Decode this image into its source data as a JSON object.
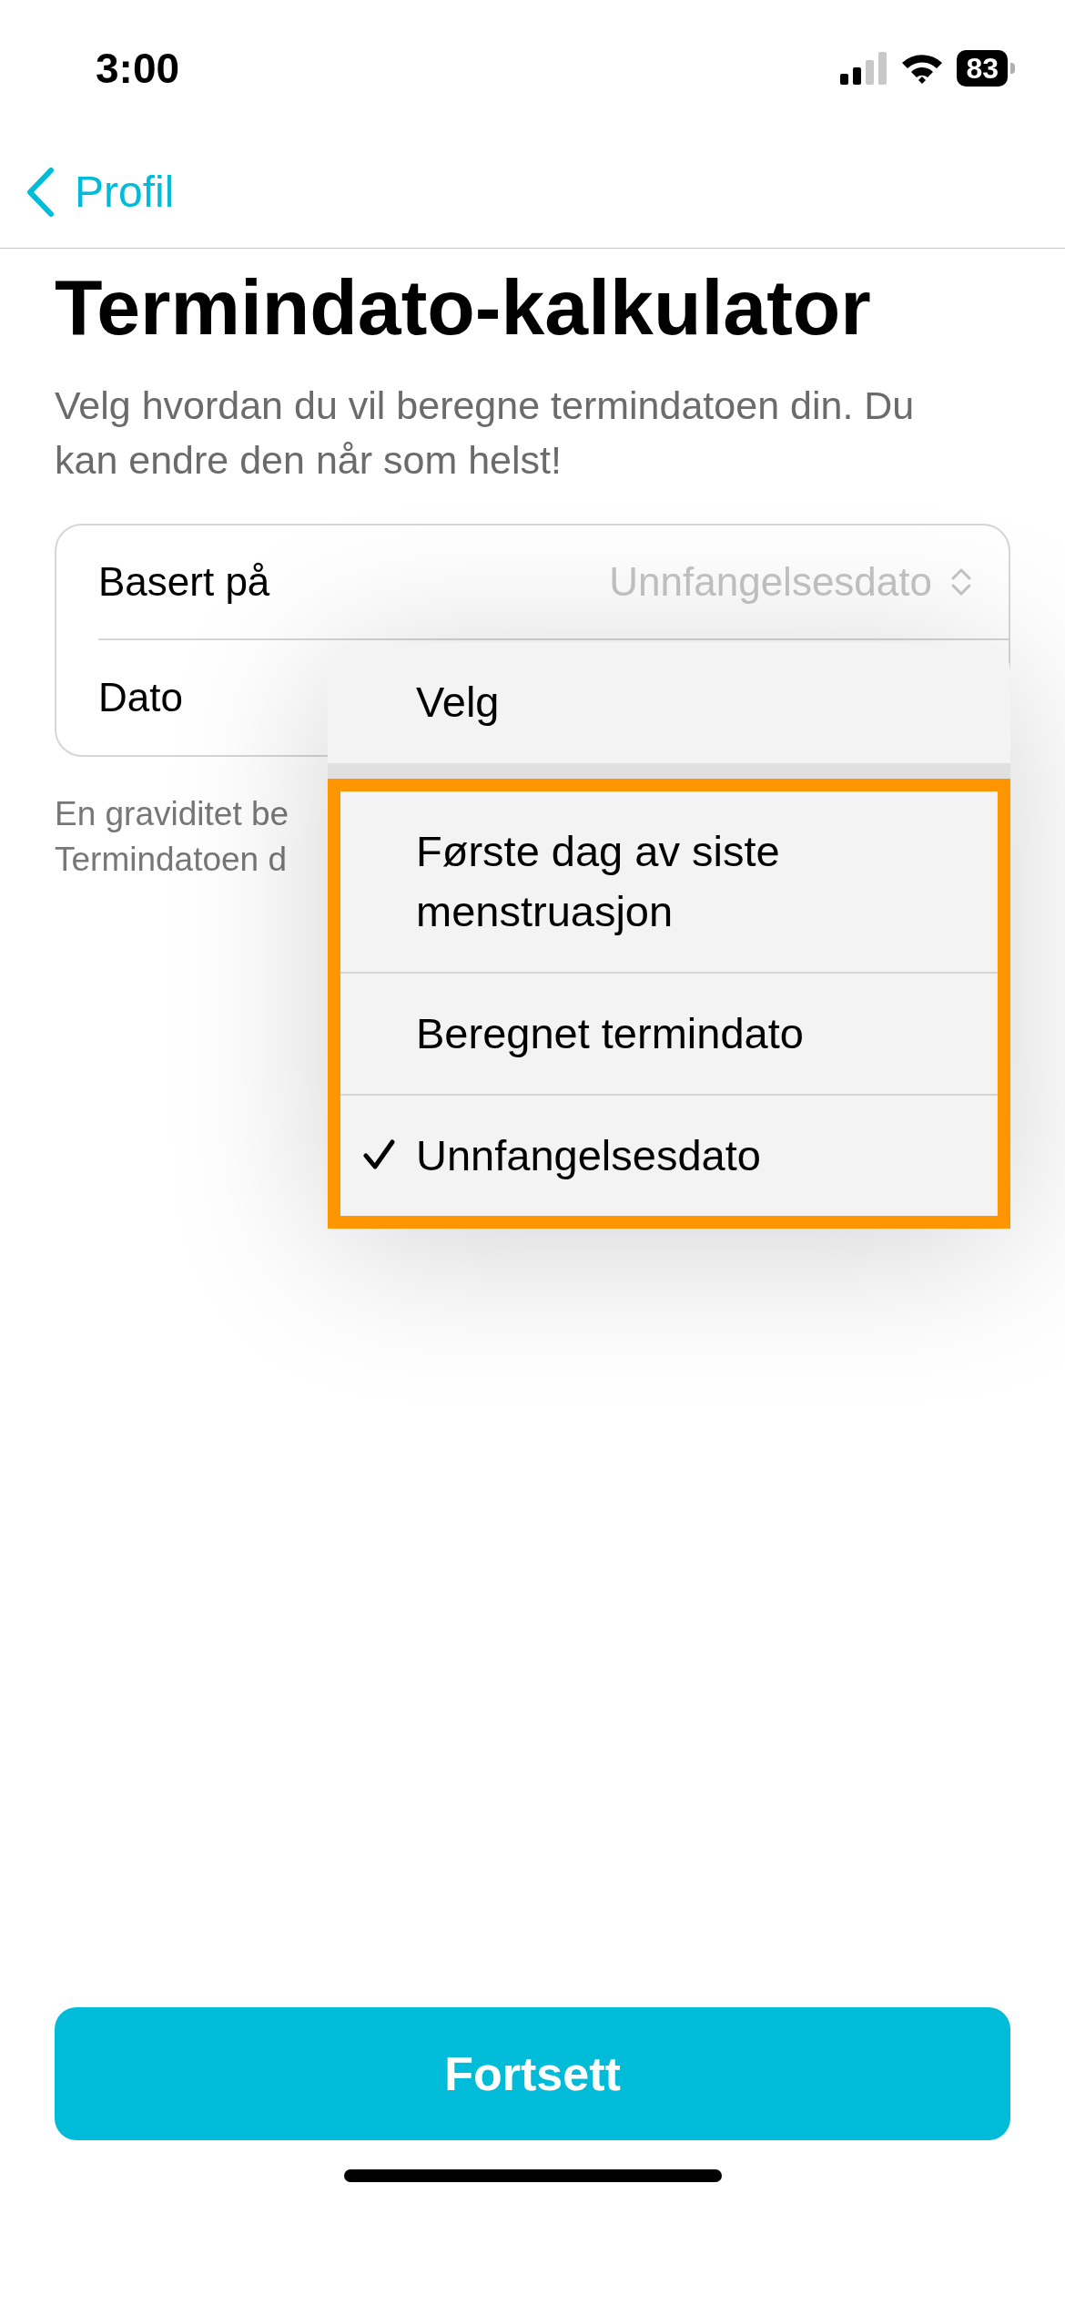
{
  "status_bar": {
    "time": "3:00",
    "battery": "83"
  },
  "nav": {
    "back_label": "Profil"
  },
  "title": "Termindato-kalkulator",
  "subtitle": "Velg hvordan du vil beregne termindatoen din. Du kan endre den når som helst!",
  "form": {
    "rows": [
      {
        "label": "Basert på",
        "value": "Unnfangelsesdato"
      },
      {
        "label": "Dato"
      }
    ]
  },
  "footnote_lines": [
    "En graviditet be",
    "Termindatoen d"
  ],
  "menu": {
    "header": "Velg",
    "options_highlighted": true,
    "options": [
      {
        "label": "Første dag av siste menstruasjon",
        "selected": false
      },
      {
        "label": "Beregnet termindato",
        "selected": false
      },
      {
        "label": "Unnfangelsesdato",
        "selected": true
      }
    ]
  },
  "button": "Fortsett"
}
